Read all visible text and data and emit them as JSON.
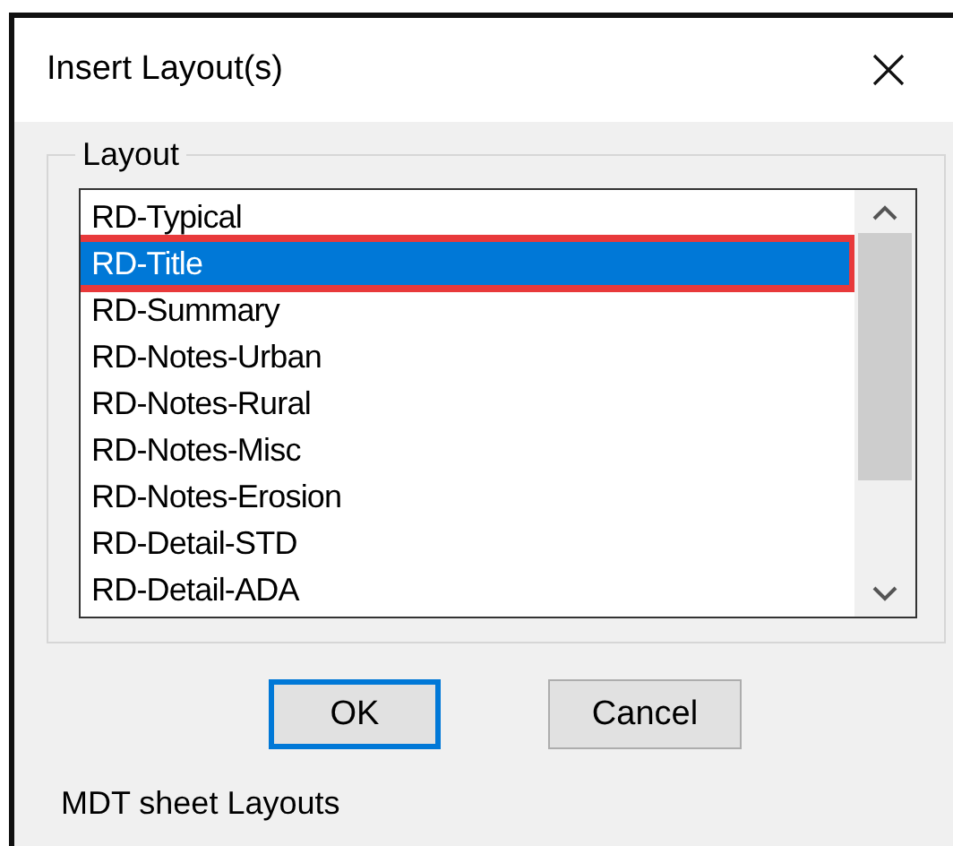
{
  "window": {
    "title": "Insert Layout(s)"
  },
  "group": {
    "label": "Layout"
  },
  "list": {
    "items": [
      {
        "label": "RD-Typical",
        "selected": false
      },
      {
        "label": "RD-Title",
        "selected": true
      },
      {
        "label": "RD-Summary",
        "selected": false
      },
      {
        "label": "RD-Notes-Urban",
        "selected": false
      },
      {
        "label": "RD-Notes-Rural",
        "selected": false
      },
      {
        "label": "RD-Notes-Misc",
        "selected": false
      },
      {
        "label": "RD-Notes-Erosion",
        "selected": false
      },
      {
        "label": "RD-Detail-STD",
        "selected": false
      },
      {
        "label": "RD-Detail-ADA",
        "selected": false
      }
    ]
  },
  "buttons": [
    {
      "label": "OK",
      "default": true
    },
    {
      "label": "Cancel",
      "default": false
    }
  ],
  "status_text": "MDT sheet Layouts"
}
